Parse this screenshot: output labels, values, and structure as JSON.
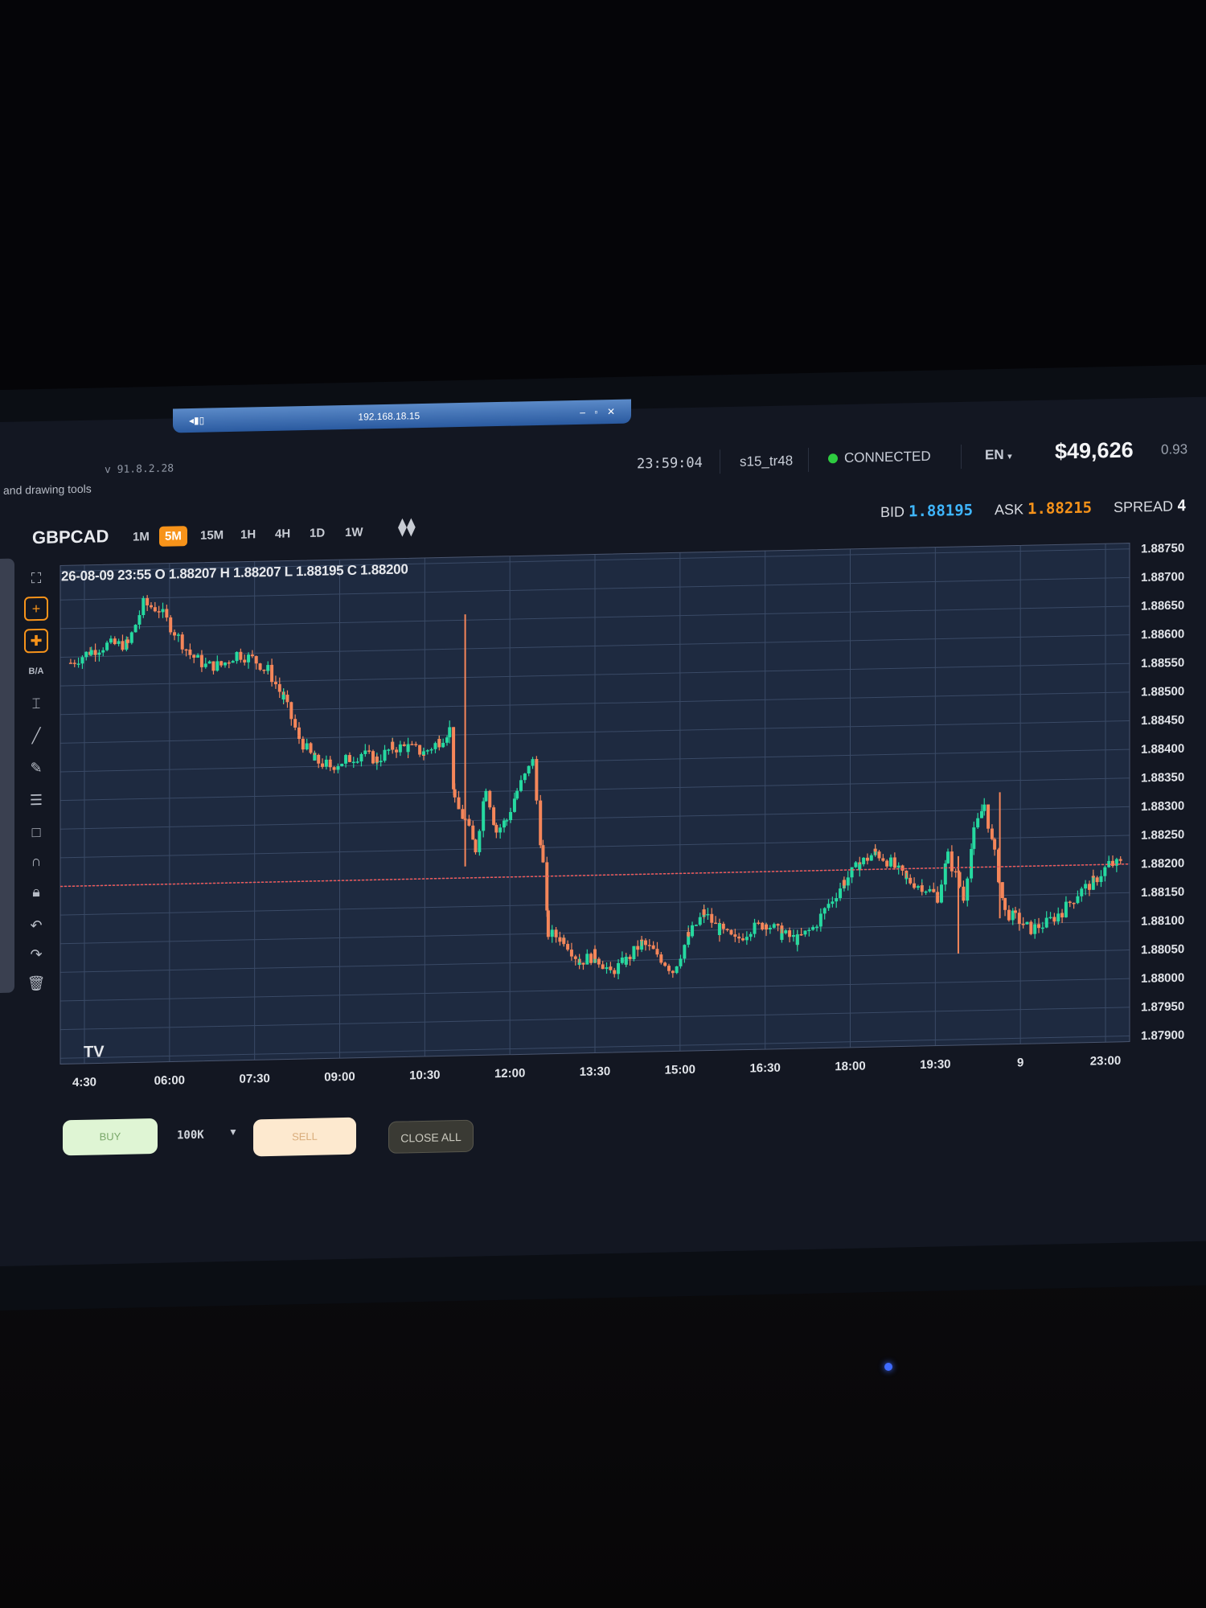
{
  "remote_bar": {
    "address": "192.168.18.15",
    "signal_icon": "signal-bars-icon",
    "controls": [
      "–",
      "▫",
      "✕"
    ]
  },
  "header": {
    "version": "v 91.8.2.28",
    "tools_note": "and drawing tools",
    "clock": "23:59:04",
    "user": "s15_tr48",
    "status": "CONNECTED",
    "status_color": "#2ecc40",
    "language": "EN",
    "balance": "$49,626",
    "small_value": "0.93"
  },
  "toolbar": {
    "symbol": "GBPCAD",
    "timeframes": [
      "1M",
      "5M",
      "15M",
      "1H",
      "4H",
      "1D",
      "1W"
    ],
    "active_timeframe": "5M",
    "bid_label": "BID",
    "bid": "1.88195",
    "ask_label": "ASK",
    "ask": "1.88215",
    "spread_label": "SPREAD",
    "spread": "4"
  },
  "left_tools": [
    "fullscreen-icon",
    "crosshair-icon",
    "crosshair-plus-icon",
    "B/A",
    "ruler-icon",
    "line-icon",
    "pencil-icon",
    "fib-lines-icon",
    "rectangle-icon",
    "magnet-icon",
    "lock-icon",
    "undo-icon",
    "redo-icon",
    "trash-icon"
  ],
  "chart_data": {
    "type": "candlestick",
    "symbol": "GBPCAD",
    "timeframe": "5M",
    "ohlc_readout": "26-08-09 23:55 O 1.88207 H 1.88207 L 1.88195 C 1.88200",
    "x_tick_labels": [
      "4:30",
      "06:00",
      "07:30",
      "09:00",
      "10:30",
      "12:00",
      "13:30",
      "15:00",
      "16:30",
      "18:00",
      "19:30",
      "9",
      "23:00"
    ],
    "y_tick_labels": [
      "1.88750",
      "1.88700",
      "1.88650",
      "1.88600",
      "1.88550",
      "1.88500",
      "1.88450",
      "1.88400",
      "1.88350",
      "1.88300",
      "1.88250",
      "1.88200",
      "1.88150",
      "1.88100",
      "1.88050",
      "1.88000",
      "1.87950",
      "1.87900"
    ],
    "ylim": [
      1.8789,
      1.8876
    ],
    "current_price_line": 1.882,
    "up_color": "#26d9a0",
    "down_color": "#f5865a",
    "grid": true,
    "close_path": [
      [
        4.6,
        1.8859
      ],
      [
        5.0,
        1.8861
      ],
      [
        5.3,
        1.8862
      ],
      [
        5.7,
        1.8862
      ],
      [
        6.0,
        1.8869
      ],
      [
        6.3,
        1.8868
      ],
      [
        6.6,
        1.8864
      ],
      [
        6.9,
        1.886
      ],
      [
        7.2,
        1.8858
      ],
      [
        7.5,
        1.8858
      ],
      [
        7.8,
        1.886
      ],
      [
        8.1,
        1.8859
      ],
      [
        8.4,
        1.8857
      ],
      [
        8.7,
        1.8852
      ],
      [
        9.0,
        1.8845
      ],
      [
        9.3,
        1.8841
      ],
      [
        9.6,
        1.884
      ],
      [
        9.9,
        1.8841
      ],
      [
        10.2,
        1.8842
      ],
      [
        10.5,
        1.8841
      ],
      [
        10.8,
        1.8843
      ],
      [
        11.1,
        1.8843
      ],
      [
        11.4,
        1.8842
      ],
      [
        11.7,
        1.8844
      ],
      [
        11.9,
        1.8846
      ],
      [
        12.0,
        1.8833
      ],
      [
        12.2,
        1.883
      ],
      [
        12.4,
        1.8825
      ],
      [
        12.6,
        1.8836
      ],
      [
        12.8,
        1.8828
      ],
      [
        13.0,
        1.883
      ],
      [
        13.2,
        1.8835
      ],
      [
        13.5,
        1.884
      ],
      [
        13.7,
        1.8822
      ],
      [
        13.8,
        1.881
      ],
      [
        14.1,
        1.8809
      ],
      [
        14.4,
        1.8805
      ],
      [
        14.7,
        1.8806
      ],
      [
        15.0,
        1.8803
      ],
      [
        15.3,
        1.8805
      ],
      [
        15.6,
        1.8808
      ],
      [
        15.9,
        1.8806
      ],
      [
        16.2,
        1.8803
      ],
      [
        16.5,
        1.8809
      ],
      [
        16.8,
        1.8813
      ],
      [
        17.1,
        1.881
      ],
      [
        17.4,
        1.8808
      ],
      [
        17.7,
        1.881
      ],
      [
        18.0,
        1.8811
      ],
      [
        18.3,
        1.8809
      ],
      [
        18.6,
        1.8808
      ],
      [
        18.9,
        1.881
      ],
      [
        19.2,
        1.8814
      ],
      [
        19.5,
        1.8818
      ],
      [
        19.8,
        1.8821
      ],
      [
        20.1,
        1.8823
      ],
      [
        20.4,
        1.8821
      ],
      [
        20.7,
        1.8818
      ],
      [
        21.0,
        1.8817
      ],
      [
        21.3,
        1.8815
      ],
      [
        21.5,
        1.8822
      ],
      [
        21.8,
        1.8815
      ],
      [
        22.0,
        1.8826
      ],
      [
        22.2,
        1.8831
      ],
      [
        22.4,
        1.8822
      ],
      [
        22.6,
        1.8812
      ],
      [
        22.8,
        1.8811
      ],
      [
        23.1,
        1.8809
      ],
      [
        23.4,
        1.881
      ],
      [
        23.7,
        1.8812
      ],
      [
        24.0,
        1.8815
      ],
      [
        24.3,
        1.8817
      ],
      [
        24.6,
        1.882
      ],
      [
        24.9,
        1.882
      ]
    ],
    "spikes": [
      {
        "x": 12.2,
        "high": 1.8866,
        "low": 1.8822,
        "dir": "down"
      },
      {
        "x": 22.5,
        "high": 1.8833,
        "low": 1.8811,
        "dir": "down"
      },
      {
        "x": 21.7,
        "high": 1.8822,
        "low": 1.8805,
        "dir": "down"
      }
    ]
  },
  "trade_bar": {
    "buy": "BUY",
    "lot": "100K",
    "sell": "SELL",
    "close_all": "CLOSE ALL"
  }
}
